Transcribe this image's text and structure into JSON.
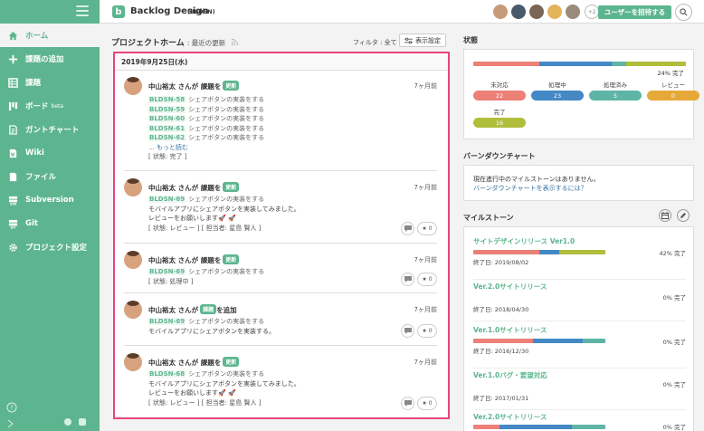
{
  "sidebar": {
    "items": [
      {
        "label": "ホーム",
        "icon": "home-icon"
      },
      {
        "label": "課題の追加",
        "icon": "plus-icon"
      },
      {
        "label": "課題",
        "icon": "list-icon"
      },
      {
        "label": "ボード",
        "sup": "beta",
        "icon": "board-icon"
      },
      {
        "label": "ガントチャート",
        "icon": "gantt-icon"
      },
      {
        "label": "Wiki",
        "icon": "wiki-icon"
      },
      {
        "label": "ファイル",
        "icon": "file-icon"
      },
      {
        "label": "Subversion",
        "icon": "svn-icon"
      },
      {
        "label": "Git",
        "icon": "git-icon"
      },
      {
        "label": "プロジェクト設定",
        "icon": "gear-icon"
      }
    ]
  },
  "header": {
    "project_name": "Backlog Design",
    "project_key": "(BLDSN)",
    "more_users": "+2",
    "invite_label": "ユーザーを招待する"
  },
  "main": {
    "title": "プロジェクトホーム",
    "subtitle": "最近の更新",
    "filter_label": "フィルタ : 全て",
    "display_settings": "表示設定",
    "date": "2019年9月25日(水)",
    "entries": [
      {
        "user": "中山裕太 さんが 課題を",
        "tag": "更新",
        "time": "7ヶ月前",
        "issues": [
          {
            "key": "BLDSN-58",
            "text": "シェアボタンの実装をする"
          },
          {
            "key": "BLDSN-59",
            "text": "シェアボタンの実装をする"
          },
          {
            "key": "BLDSN-60",
            "text": "シェアボタンの実装をする"
          },
          {
            "key": "BLDSN-61",
            "text": "シェアボタンの実装をする"
          },
          {
            "key": "BLDSN-62",
            "text": "シェアボタンの実装をする"
          }
        ],
        "more": "... もっと読む",
        "status": "[ 状態: 完了 ]"
      },
      {
        "user": "中山裕太 さんが 課題を",
        "tag": "更新",
        "time": "7ヶ月前",
        "issue": {
          "key": "BLDSN-69",
          "text": "シェアボタンの実装をする"
        },
        "comment1": "モバイルアプリにシェアボタンを実装してみました。",
        "comment2": "レビューをお願いします🚀 🚀",
        "status": "[ 状態: レビュー ] [ 担当者: 星島 賢人 ]",
        "stars": "0"
      },
      {
        "user": "中山裕太 さんが 課題を",
        "tag": "更新",
        "time": "7ヶ月前",
        "issue": {
          "key": "BLDSN-69",
          "text": "シェアボタンの実装をする"
        },
        "status": "[ 状態: 処理中 ]",
        "stars": "0"
      },
      {
        "user": "中山裕太 さんが",
        "tag": "課題",
        "suffix": "を追加",
        "time": "7ヶ月前",
        "issue": {
          "key": "BLDSN-69",
          "text": "シェアボタンの実装をする"
        },
        "comment1": "モバイルアプリにシェアボタンを実装する。",
        "stars": "0"
      },
      {
        "user": "中山裕太 さんが 課題を",
        "tag": "更新",
        "time": "7ヶ月前",
        "issue": {
          "key": "BLDSN-68",
          "text": "シェアボタンの実装をする"
        },
        "comment1": "モバイルアプリにシェアボタンを実装してみました。",
        "comment2": "レビューをお願いします🚀 🚀",
        "status": "[ 状態: レビュー ] [ 担当者: 星島 賢人 ]",
        "stars": "0"
      }
    ]
  },
  "status_panel": {
    "title": "状態",
    "percent": "24% 完了",
    "fractions": {
      "open": 0.31,
      "in_progress": 0.34,
      "resolved": 0.07,
      "closed": 0.28
    },
    "colors": {
      "open": "#ed8077",
      "in_progress": "#4488c5",
      "resolved": "#5eb5a6",
      "review": "#e6a939",
      "closed": "#b0be3c"
    },
    "items": [
      {
        "label": "未対応",
        "count": "22"
      },
      {
        "label": "処理中",
        "count": "23"
      },
      {
        "label": "処理済み",
        "count": "5"
      },
      {
        "label": "レビュー",
        "count": "0"
      },
      {
        "label": "完了",
        "count": "16"
      }
    ]
  },
  "burndown": {
    "title": "バーンダウンチャート",
    "text": "現在進行中のマイルストーンはありません。",
    "link": "バーンダウンチャートを表示するには？"
  },
  "milestones": {
    "title": "マイルストーン",
    "items": [
      {
        "name": "サイトデザインリリース Ver1.0",
        "pct": "42% 完了",
        "due": "終了日: 2019/08/02"
      },
      {
        "name": "Ver.2.0サイトリリース",
        "pct": "0% 完了",
        "due": "終了日: 2018/04/30"
      },
      {
        "name": "Ver.1.0サイトリリース",
        "pct": "0% 完了",
        "due": "終了日: 2016/12/30"
      },
      {
        "name": "Ver.1.0バグ・要望対応",
        "pct": "0% 完了",
        "due": "終了日: 2017/01/31"
      },
      {
        "name": "Ver.2.0サイトリリース",
        "pct": "0% 完了",
        "due": ""
      }
    ]
  }
}
